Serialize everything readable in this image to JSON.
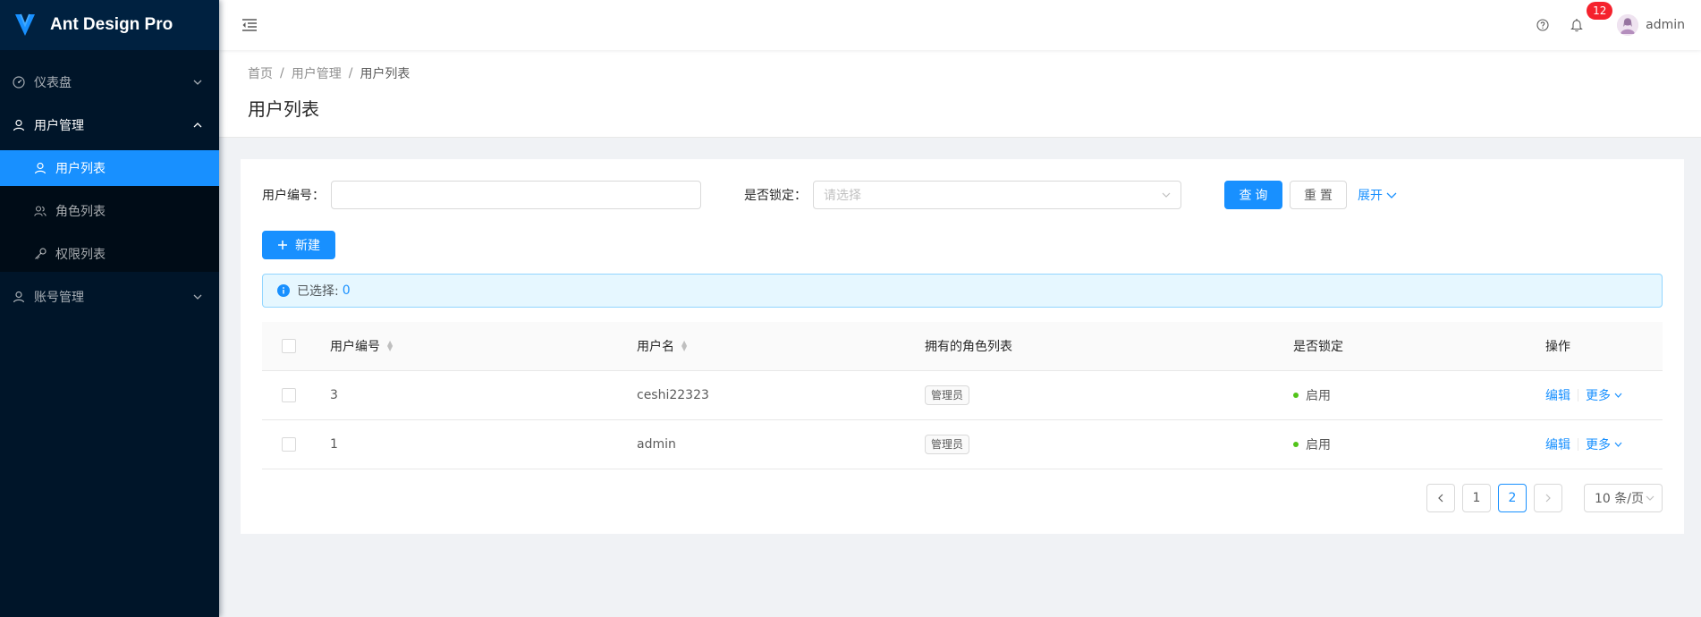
{
  "app": {
    "title": "Ant Design Pro"
  },
  "sidebar": {
    "items": [
      {
        "label": "仪表盘",
        "icon": "dashboard-icon",
        "open": false
      },
      {
        "label": "用户管理",
        "icon": "user-icon",
        "open": true,
        "children": [
          {
            "label": "用户列表",
            "icon": "user-icon",
            "active": true
          },
          {
            "label": "角色列表",
            "icon": "team-icon",
            "active": false
          },
          {
            "label": "权限列表",
            "icon": "key-icon",
            "active": false
          }
        ]
      },
      {
        "label": "账号管理",
        "icon": "user-icon",
        "open": false
      }
    ]
  },
  "header": {
    "notification_count": "12",
    "username": "admin",
    "icons": [
      "menu-fold-icon",
      "question-circle-icon",
      "bell-icon"
    ]
  },
  "breadcrumb": [
    "首页",
    "用户管理",
    "用户列表"
  ],
  "page": {
    "title": "用户列表"
  },
  "search": {
    "user_id_label": "用户编号：",
    "user_id_value": "",
    "locked_label": "是否锁定：",
    "locked_placeholder": "请选择",
    "query_label": "查 询",
    "reset_label": "重 置",
    "expand_label": "展开"
  },
  "toolbar": {
    "new_label": "新建"
  },
  "selection": {
    "label": "已选择:",
    "count": "0"
  },
  "table": {
    "columns": [
      "用户编号",
      "用户名",
      "拥有的角色列表",
      "是否锁定",
      "操作"
    ],
    "rows": [
      {
        "id": "3",
        "username": "ceshi22323",
        "role": "管理员",
        "status": "启用",
        "edit": "编辑",
        "more": "更多"
      },
      {
        "id": "1",
        "username": "admin",
        "role": "管理员",
        "status": "启用",
        "edit": "编辑",
        "more": "更多"
      }
    ]
  },
  "pagination": {
    "pages": [
      "1",
      "2"
    ],
    "current": "2",
    "page_size": "10 条/页"
  },
  "colors": {
    "primary": "#1890ff",
    "sider_bg": "#001529",
    "success": "#52c41a",
    "danger": "#f5222d"
  }
}
